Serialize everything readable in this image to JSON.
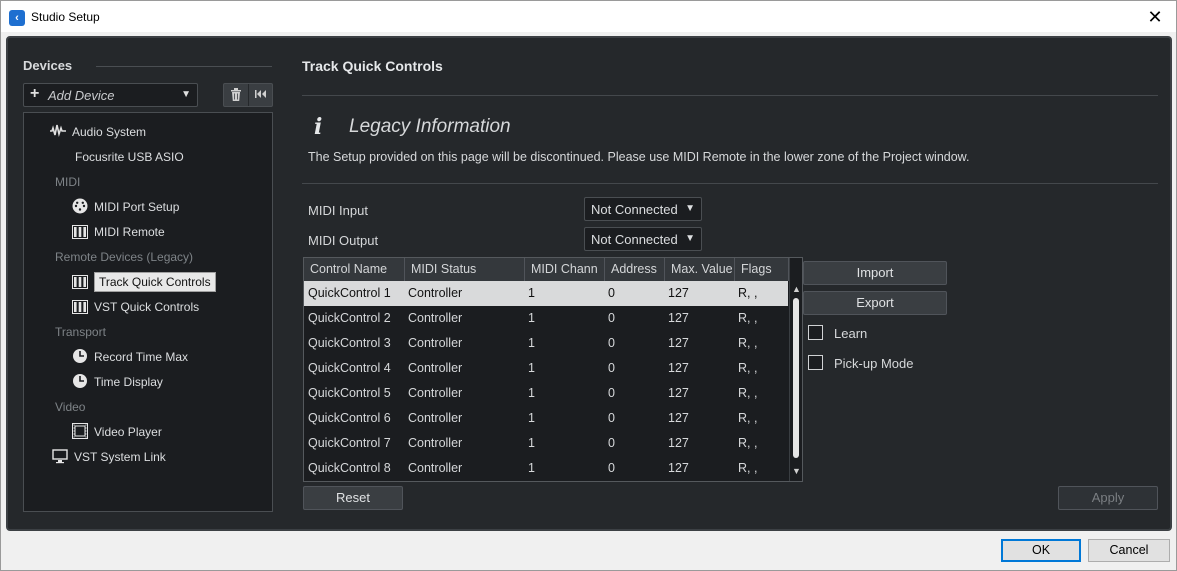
{
  "window": {
    "title": "Studio Setup",
    "close_glyph": "✕"
  },
  "devices": {
    "header": "Devices",
    "add_device": "Add Device",
    "tree": [
      {
        "label": "Audio System",
        "kind": "item",
        "icon": "audio-wave-icon"
      },
      {
        "label": "Focusrite USB ASIO",
        "kind": "item",
        "icon": ""
      },
      {
        "label": "MIDI",
        "kind": "category"
      },
      {
        "label": "MIDI Port Setup",
        "kind": "item",
        "icon": "midi-port-icon"
      },
      {
        "label": "MIDI Remote",
        "kind": "item",
        "icon": "keyboard-icon"
      },
      {
        "label": "Remote Devices (Legacy)",
        "kind": "category"
      },
      {
        "label": "Track Quick Controls",
        "kind": "item",
        "icon": "keyboard-icon",
        "selected": true
      },
      {
        "label": "VST Quick Controls",
        "kind": "item",
        "icon": "keyboard-icon"
      },
      {
        "label": "Transport",
        "kind": "category"
      },
      {
        "label": "Record Time Max",
        "kind": "item",
        "icon": "clock-icon"
      },
      {
        "label": "Time Display",
        "kind": "item",
        "icon": "clock-icon"
      },
      {
        "label": "Video",
        "kind": "category"
      },
      {
        "label": "Video Player",
        "kind": "item",
        "icon": "film-icon"
      },
      {
        "label": "VST System Link",
        "kind": "item",
        "icon": "monitor-icon"
      }
    ]
  },
  "panel": {
    "title": "Track Quick Controls",
    "info_title": "Legacy Information",
    "info_text": "The Setup provided on this page will be discontinued. Please use MIDI Remote in the lower zone of the Project window.",
    "midi_input_label": "MIDI Input",
    "midi_input_value": "Not Connected",
    "midi_output_label": "MIDI Output",
    "midi_output_value": "Not Connected"
  },
  "table": {
    "columns": [
      "Control Name",
      "MIDI Status",
      "MIDI Chann",
      "Address",
      "Max. Value",
      "Flags"
    ],
    "rows": [
      [
        "QuickControl 1",
        "Controller",
        "1",
        "0",
        "127",
        "R, ,"
      ],
      [
        "QuickControl 2",
        "Controller",
        "1",
        "0",
        "127",
        "R, ,"
      ],
      [
        "QuickControl 3",
        "Controller",
        "1",
        "0",
        "127",
        "R, ,"
      ],
      [
        "QuickControl 4",
        "Controller",
        "1",
        "0",
        "127",
        "R, ,"
      ],
      [
        "QuickControl 5",
        "Controller",
        "1",
        "0",
        "127",
        "R, ,"
      ],
      [
        "QuickControl 6",
        "Controller",
        "1",
        "0",
        "127",
        "R, ,"
      ],
      [
        "QuickControl 7",
        "Controller",
        "1",
        "0",
        "127",
        "R, ,"
      ],
      [
        "QuickControl 8",
        "Controller",
        "1",
        "0",
        "127",
        "R, ,"
      ]
    ],
    "selected_row": 0
  },
  "actions": {
    "import": "Import",
    "export": "Export",
    "learn": "Learn",
    "pickup": "Pick-up Mode",
    "reset": "Reset",
    "apply": "Apply"
  },
  "dialog": {
    "ok": "OK",
    "cancel": "Cancel"
  },
  "colors": {
    "background": "#25282b",
    "field": "#1b1d20",
    "selection": "#d9dadb",
    "ok_border": "#0078d7"
  }
}
